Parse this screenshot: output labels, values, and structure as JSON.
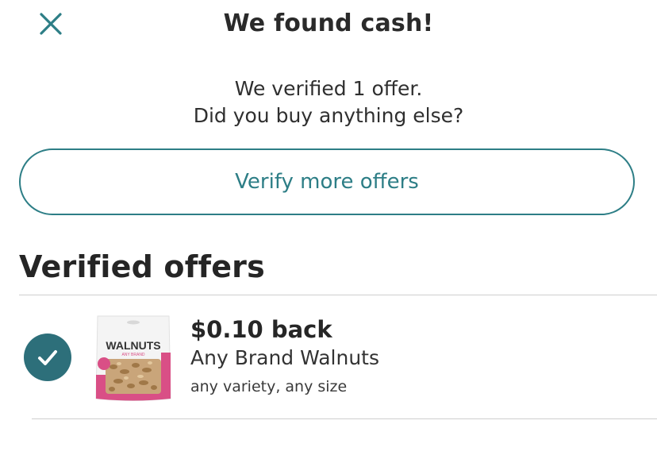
{
  "header": {
    "title": "We found cash!",
    "close_icon": "close-icon"
  },
  "message": {
    "line1": "We verified 1 offer.",
    "line2": "Did you buy anything else?"
  },
  "verify_button": {
    "label": "Verify more offers"
  },
  "verified_section": {
    "heading": "Verified offers",
    "offers": [
      {
        "amount": "$0.10 back",
        "name": "Any Brand Walnuts",
        "detail": "any variety, any size",
        "status_icon": "checkmark-icon",
        "product_label": "WALNUTS",
        "product_sublabel": "ANY BRAND"
      }
    ]
  },
  "colors": {
    "accent": "#2d7e86",
    "check_bg": "#2d6f7a",
    "package_pink": "#d94f86",
    "divider": "#cfcfcf"
  }
}
